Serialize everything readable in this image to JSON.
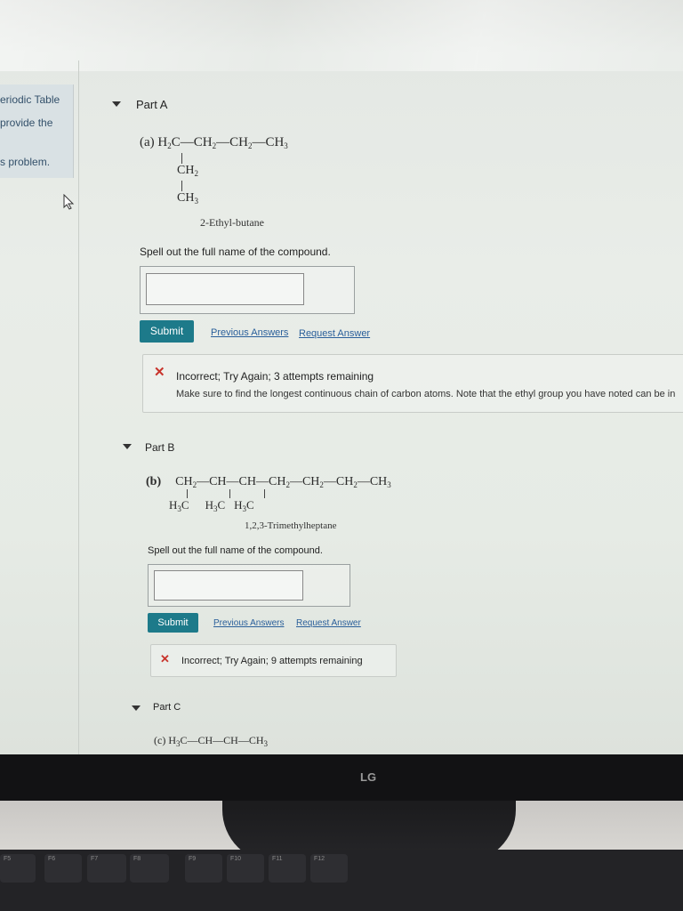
{
  "sidebar": {
    "lines": [
      "eriodic Table",
      "provide the",
      "s problem."
    ]
  },
  "partA": {
    "title": "Part A",
    "label": "(a)",
    "main_chain": [
      "H",
      "2",
      "C—CH",
      "2",
      "—CH",
      "2",
      "—CH",
      "3"
    ],
    "branch_1": [
      "CH",
      "2"
    ],
    "branch_2": [
      "CH",
      "3"
    ],
    "name_caption": "2-Ethyl-butane",
    "prompt": "Spell out the full name of the compound.",
    "submit_label": "Submit",
    "previous_answers": "Previous Answers",
    "request_answer": "Request Answer",
    "feedback_title": "Incorrect; Try Again; 3 attempts remaining",
    "feedback_detail": "Make sure to find the longest continuous chain of carbon atoms. Note that the ethyl group you have noted can be in"
  },
  "partB": {
    "title": "Part B",
    "label": "(b)",
    "top_chain": [
      "CH",
      "2",
      "—CH—CH—CH",
      "2",
      "—CH",
      "2",
      "—CH",
      "2",
      "—CH",
      "3"
    ],
    "bottom_groups": [
      "H",
      "3",
      "C",
      "H",
      "3",
      "C",
      "H",
      "3",
      "C"
    ],
    "name_caption": "1,2,3-Trimethylheptane",
    "prompt": "Spell out the full name of the compound.",
    "submit_label": "Submit",
    "previous_answers": "Previous Answers",
    "request_answer": "Request Answer",
    "feedback_title": "Incorrect; Try Again; 9 attempts remaining"
  },
  "partC": {
    "title": "Part C",
    "label": "(c)",
    "chain": [
      "H",
      "3",
      "C—CH—CH—CH",
      "3"
    ]
  },
  "monitor": {
    "logo": "LG"
  },
  "keyboard": {
    "keys": [
      "F5",
      "F6",
      "F7",
      "F8",
      "F9",
      "F10",
      "F11",
      "F12"
    ]
  },
  "colors": {
    "submit": "#1d7a8a",
    "link": "#2a5f9a",
    "error": "#c8332b"
  }
}
